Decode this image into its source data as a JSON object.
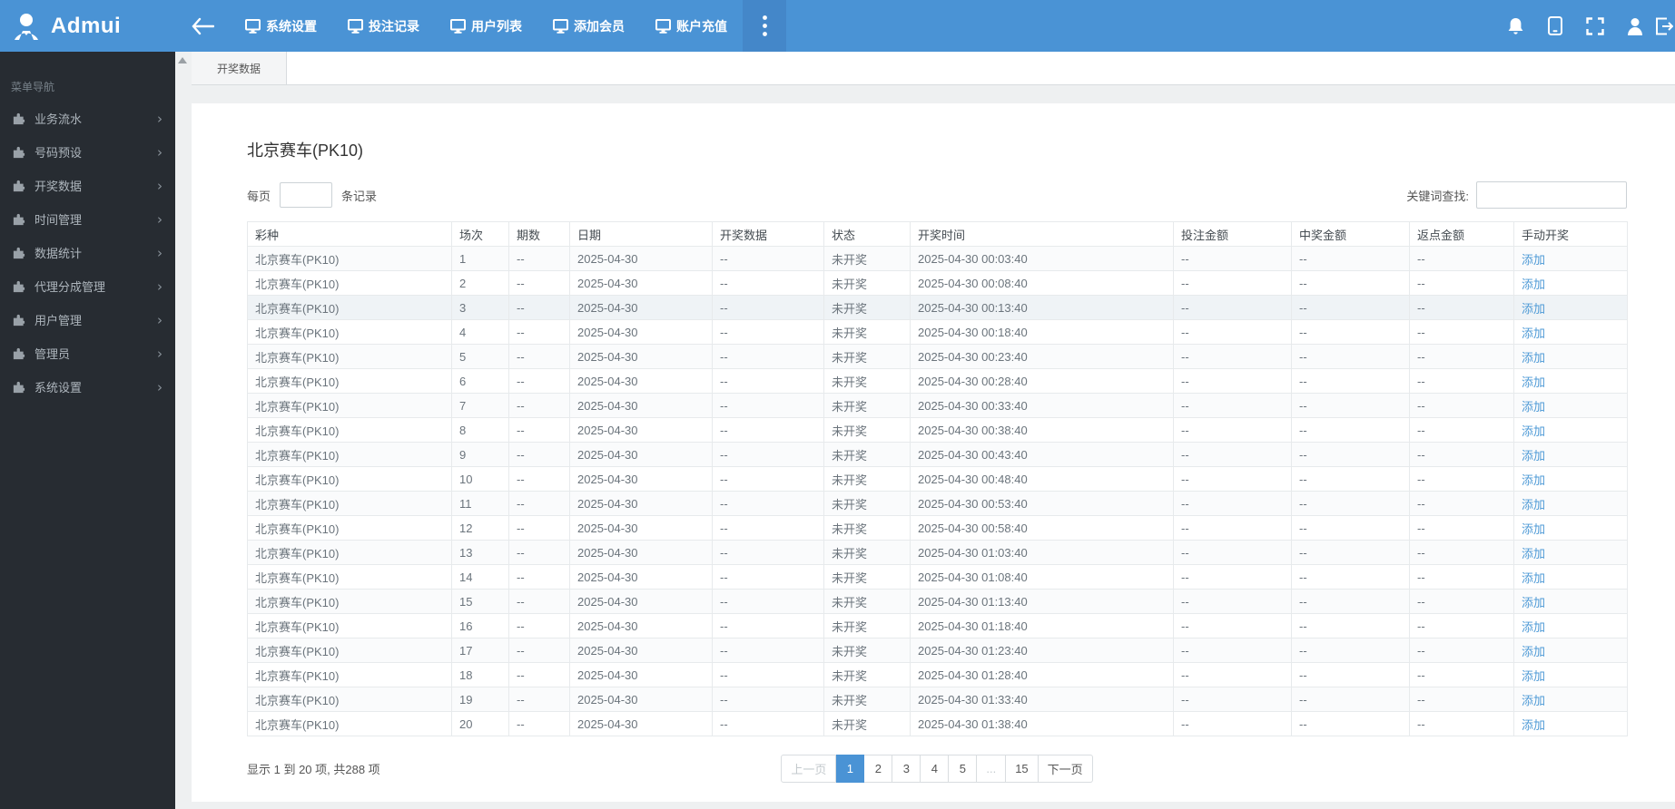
{
  "navbar": {
    "brand": "Admui",
    "menu": [
      {
        "label": "系统设置"
      },
      {
        "label": "投注记录"
      },
      {
        "label": "用户列表"
      },
      {
        "label": "添加会员"
      },
      {
        "label": "账户充值"
      }
    ],
    "right_icons": [
      {
        "name": "bell-icon"
      },
      {
        "name": "tablet-icon"
      },
      {
        "name": "fullscreen-icon"
      },
      {
        "name": "user-icon"
      },
      {
        "name": "logout-icon"
      }
    ]
  },
  "sidebar": {
    "nav_label": "菜单导航",
    "items": [
      {
        "label": "业务流水"
      },
      {
        "label": "号码预设"
      },
      {
        "label": "开奖数据"
      },
      {
        "label": "时间管理"
      },
      {
        "label": "数据统计"
      },
      {
        "label": "代理分成管理"
      },
      {
        "label": "用户管理"
      },
      {
        "label": "管理员"
      },
      {
        "label": "系统设置"
      }
    ]
  },
  "tabs": [
    {
      "label": "开奖数据",
      "active": true
    }
  ],
  "main": {
    "title": "北京赛车(PK10)",
    "per_page": {
      "prefix": "每页",
      "suffix": "条记录",
      "value": ""
    },
    "search": {
      "label": "关键词查找:",
      "value": ""
    },
    "table": {
      "headers": [
        "彩种",
        "场次",
        "期数",
        "日期",
        "开奖数据",
        "状态",
        "开奖时间",
        "投注金额",
        "中奖金额",
        "返点金额",
        "手动开奖"
      ],
      "col_keys": [
        "lottery",
        "session",
        "issue",
        "date",
        "draw-data",
        "status",
        "draw-time",
        "bet-amount",
        "win-amount",
        "rebate-amount",
        "action"
      ],
      "hovered_row_index": 2,
      "rows": [
        [
          "北京赛车(PK10)",
          "1",
          "--",
          "2025-04-30",
          "--",
          "未开奖",
          "2025-04-30 00:03:40",
          "--",
          "--",
          "--",
          "添加"
        ],
        [
          "北京赛车(PK10)",
          "2",
          "--",
          "2025-04-30",
          "--",
          "未开奖",
          "2025-04-30 00:08:40",
          "--",
          "--",
          "--",
          "添加"
        ],
        [
          "北京赛车(PK10)",
          "3",
          "--",
          "2025-04-30",
          "--",
          "未开奖",
          "2025-04-30 00:13:40",
          "--",
          "--",
          "--",
          "添加"
        ],
        [
          "北京赛车(PK10)",
          "4",
          "--",
          "2025-04-30",
          "--",
          "未开奖",
          "2025-04-30 00:18:40",
          "--",
          "--",
          "--",
          "添加"
        ],
        [
          "北京赛车(PK10)",
          "5",
          "--",
          "2025-04-30",
          "--",
          "未开奖",
          "2025-04-30 00:23:40",
          "--",
          "--",
          "--",
          "添加"
        ],
        [
          "北京赛车(PK10)",
          "6",
          "--",
          "2025-04-30",
          "--",
          "未开奖",
          "2025-04-30 00:28:40",
          "--",
          "--",
          "--",
          "添加"
        ],
        [
          "北京赛车(PK10)",
          "7",
          "--",
          "2025-04-30",
          "--",
          "未开奖",
          "2025-04-30 00:33:40",
          "--",
          "--",
          "--",
          "添加"
        ],
        [
          "北京赛车(PK10)",
          "8",
          "--",
          "2025-04-30",
          "--",
          "未开奖",
          "2025-04-30 00:38:40",
          "--",
          "--",
          "--",
          "添加"
        ],
        [
          "北京赛车(PK10)",
          "9",
          "--",
          "2025-04-30",
          "--",
          "未开奖",
          "2025-04-30 00:43:40",
          "--",
          "--",
          "--",
          "添加"
        ],
        [
          "北京赛车(PK10)",
          "10",
          "--",
          "2025-04-30",
          "--",
          "未开奖",
          "2025-04-30 00:48:40",
          "--",
          "--",
          "--",
          "添加"
        ],
        [
          "北京赛车(PK10)",
          "11",
          "--",
          "2025-04-30",
          "--",
          "未开奖",
          "2025-04-30 00:53:40",
          "--",
          "--",
          "--",
          "添加"
        ],
        [
          "北京赛车(PK10)",
          "12",
          "--",
          "2025-04-30",
          "--",
          "未开奖",
          "2025-04-30 00:58:40",
          "--",
          "--",
          "--",
          "添加"
        ],
        [
          "北京赛车(PK10)",
          "13",
          "--",
          "2025-04-30",
          "--",
          "未开奖",
          "2025-04-30 01:03:40",
          "--",
          "--",
          "--",
          "添加"
        ],
        [
          "北京赛车(PK10)",
          "14",
          "--",
          "2025-04-30",
          "--",
          "未开奖",
          "2025-04-30 01:08:40",
          "--",
          "--",
          "--",
          "添加"
        ],
        [
          "北京赛车(PK10)",
          "15",
          "--",
          "2025-04-30",
          "--",
          "未开奖",
          "2025-04-30 01:13:40",
          "--",
          "--",
          "--",
          "添加"
        ],
        [
          "北京赛车(PK10)",
          "16",
          "--",
          "2025-04-30",
          "--",
          "未开奖",
          "2025-04-30 01:18:40",
          "--",
          "--",
          "--",
          "添加"
        ],
        [
          "北京赛车(PK10)",
          "17",
          "--",
          "2025-04-30",
          "--",
          "未开奖",
          "2025-04-30 01:23:40",
          "--",
          "--",
          "--",
          "添加"
        ],
        [
          "北京赛车(PK10)",
          "18",
          "--",
          "2025-04-30",
          "--",
          "未开奖",
          "2025-04-30 01:28:40",
          "--",
          "--",
          "--",
          "添加"
        ],
        [
          "北京赛车(PK10)",
          "19",
          "--",
          "2025-04-30",
          "--",
          "未开奖",
          "2025-04-30 01:33:40",
          "--",
          "--",
          "--",
          "添加"
        ],
        [
          "北京赛车(PK10)",
          "20",
          "--",
          "2025-04-30",
          "--",
          "未开奖",
          "2025-04-30 01:38:40",
          "--",
          "--",
          "--",
          "添加"
        ]
      ]
    },
    "footer": {
      "summary": "显示 1 到 20 项, 共288 项"
    },
    "pagination": {
      "prev": "上一页",
      "pages": [
        "1",
        "2",
        "3",
        "4",
        "5",
        "...",
        "15"
      ],
      "active": "1",
      "next": "下一页"
    }
  },
  "colors": {
    "navbar": "#4a93d5",
    "navbar_active": "#4487c9",
    "sidebar": "#272c32",
    "content_bg": "#eef0f1",
    "link": "#4e9ad6",
    "pager_active": "#4a93d5",
    "row_hover": "#eff3f6"
  }
}
